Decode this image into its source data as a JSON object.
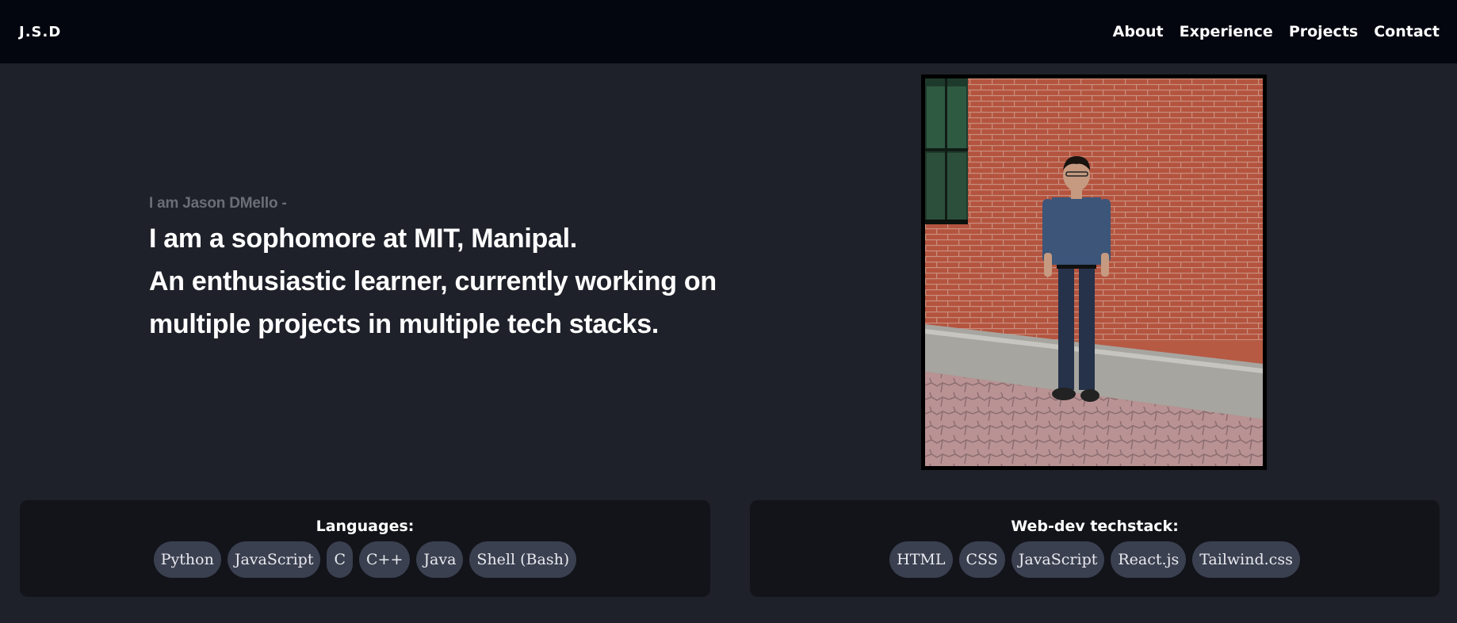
{
  "nav": {
    "logo": "J.S.D",
    "links": [
      "About",
      "Experience",
      "Projects",
      "Contact"
    ]
  },
  "hero": {
    "intro": "I am Jason DMello -",
    "lines": [
      "I am a sophomore at MIT, Manipal.",
      "An enthusiastic learner, currently working on",
      "multiple projects in multiple tech stacks."
    ]
  },
  "skills": {
    "languages": {
      "title": "Languages:",
      "items": [
        "Python",
        "JavaScript",
        "C",
        "C++",
        "Java",
        "Shell (Bash)"
      ]
    },
    "webdev": {
      "title": "Web-dev techstack:",
      "items": [
        "HTML",
        "CSS",
        "JavaScript",
        "React.js",
        "Tailwind.css"
      ]
    }
  },
  "colors": {
    "background": "#1e2129",
    "navbar": "#03050f",
    "card": "#12141a",
    "pill": "#3b4050",
    "muted_text": "#6b6e76"
  }
}
